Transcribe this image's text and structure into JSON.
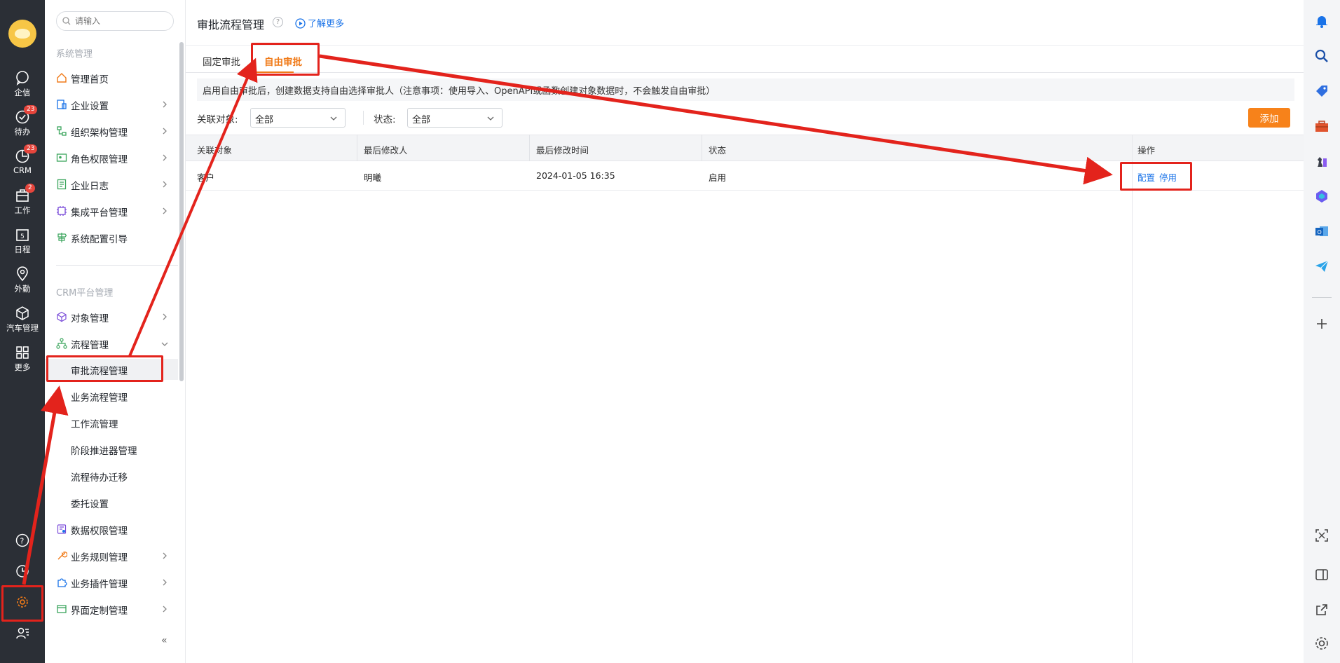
{
  "rail": {
    "items": [
      {
        "label": "企信",
        "icon": "chat-icon"
      },
      {
        "label": "待办",
        "icon": "todo-check-icon",
        "badge": "23"
      },
      {
        "label": "CRM",
        "icon": "crm-chart-icon",
        "badge": "23"
      },
      {
        "label": "工作",
        "icon": "briefcase-icon",
        "badge": "2"
      },
      {
        "label": "日程",
        "icon": "calendar-icon"
      },
      {
        "label": "外勤",
        "icon": "location-pin-icon"
      },
      {
        "label": "汽车管理",
        "icon": "cube-icon"
      },
      {
        "label": "更多",
        "icon": "grid-icon"
      }
    ],
    "bottom_icons": [
      "help-icon",
      "clock-icon",
      "settings-gear-icon",
      "user-list-icon"
    ]
  },
  "sidebar": {
    "search_placeholder": "请输入",
    "section1": "系统管理",
    "section1_items": [
      {
        "label": "管理首页",
        "icon": "home-icon"
      },
      {
        "label": "企业设置",
        "icon": "company-icon"
      },
      {
        "label": "组织架构管理",
        "icon": "org-tree-icon"
      },
      {
        "label": "角色权限管理",
        "icon": "role-card-icon"
      },
      {
        "label": "企业日志",
        "icon": "log-icon"
      },
      {
        "label": "集成平台管理",
        "icon": "chip-icon"
      },
      {
        "label": "系统配置引导",
        "icon": "signpost-icon"
      }
    ],
    "section2": "CRM平台管理",
    "object_mgmt": "对象管理",
    "process_mgmt": "流程管理",
    "process_sub": [
      "审批流程管理",
      "业务流程管理",
      "工作流管理",
      "阶段推进器管理",
      "流程待办迁移",
      "委托设置"
    ],
    "more_items": [
      {
        "label": "数据权限管理",
        "icon": "data-perm-icon"
      },
      {
        "label": "业务规则管理",
        "icon": "wrench-icon"
      },
      {
        "label": "业务插件管理",
        "icon": "puzzle-icon"
      },
      {
        "label": "界面定制管理",
        "icon": "window-icon"
      }
    ],
    "collapse": "«"
  },
  "main": {
    "title": "审批流程管理",
    "help": "?",
    "learn_more": "了解更多",
    "tabs": [
      "固定审批",
      "自由审批"
    ],
    "notice": "启用自由审批后，创建数据支持自由选择审批人（注意事项：使用导入、OpenAPI或函数创建对象数据时，不会触发自由审批）",
    "filter_object_label": "关联对象:",
    "filter_object_value": "全部",
    "filter_status_label": "状态:",
    "filter_status_value": "全部",
    "add_button": "添加",
    "columns": [
      "关联对象",
      "最后修改人",
      "最后修改时间",
      "状态",
      "操作"
    ],
    "rows": [
      {
        "object": "客户",
        "modifier": "明曦",
        "time": "2024-01-05 16:35",
        "status": "启用",
        "actions": [
          "配置",
          "停用"
        ]
      }
    ]
  },
  "right_rail_icons": [
    "bell-icon",
    "search-icon",
    "tag-icon",
    "toolbox-icon",
    "chess-icon",
    "copilot-icon",
    "outlook-icon",
    "send-icon",
    "add-icon",
    "screenshot-icon",
    "sidebar-toggle-icon",
    "external-link-icon",
    "settings-icon"
  ],
  "colors": {
    "accent": "#f07a18",
    "link": "#1a73e8",
    "annotation": "#e3231c",
    "rail": "#2b2f36"
  }
}
